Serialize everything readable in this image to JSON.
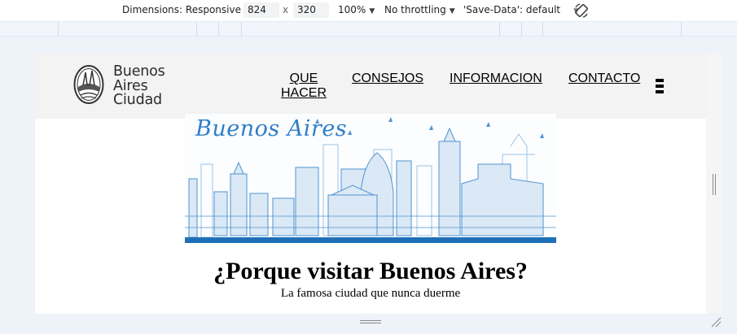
{
  "devtools": {
    "dimensions_label": "Dimensions: Responsive",
    "width_value": "824",
    "times": "x",
    "height_value": "320",
    "zoom_label": "100%",
    "throttling_label": "No throttling",
    "save_data_label": "'Save-Data': default",
    "rotate_icon": "rotate-icon"
  },
  "site": {
    "logo_lines": [
      "Buenos",
      "Aires",
      "Ciudad"
    ],
    "nav": [
      {
        "label": "QUE HACER"
      },
      {
        "label": "CONSEJOS"
      },
      {
        "label": "INFORMACION"
      },
      {
        "label": "CONTACTO"
      }
    ],
    "hero_title": "Buenos Aires",
    "headline": "¿Porque visitar Buenos Aires?",
    "subline": "La famosa ciudad que nunca duerme"
  },
  "colors": {
    "header_bg": "#f3f3f3",
    "skyline_blue": "#2f7fc6",
    "skyline_light": "#9cc3e6",
    "page_bg": "#eef2f9"
  }
}
